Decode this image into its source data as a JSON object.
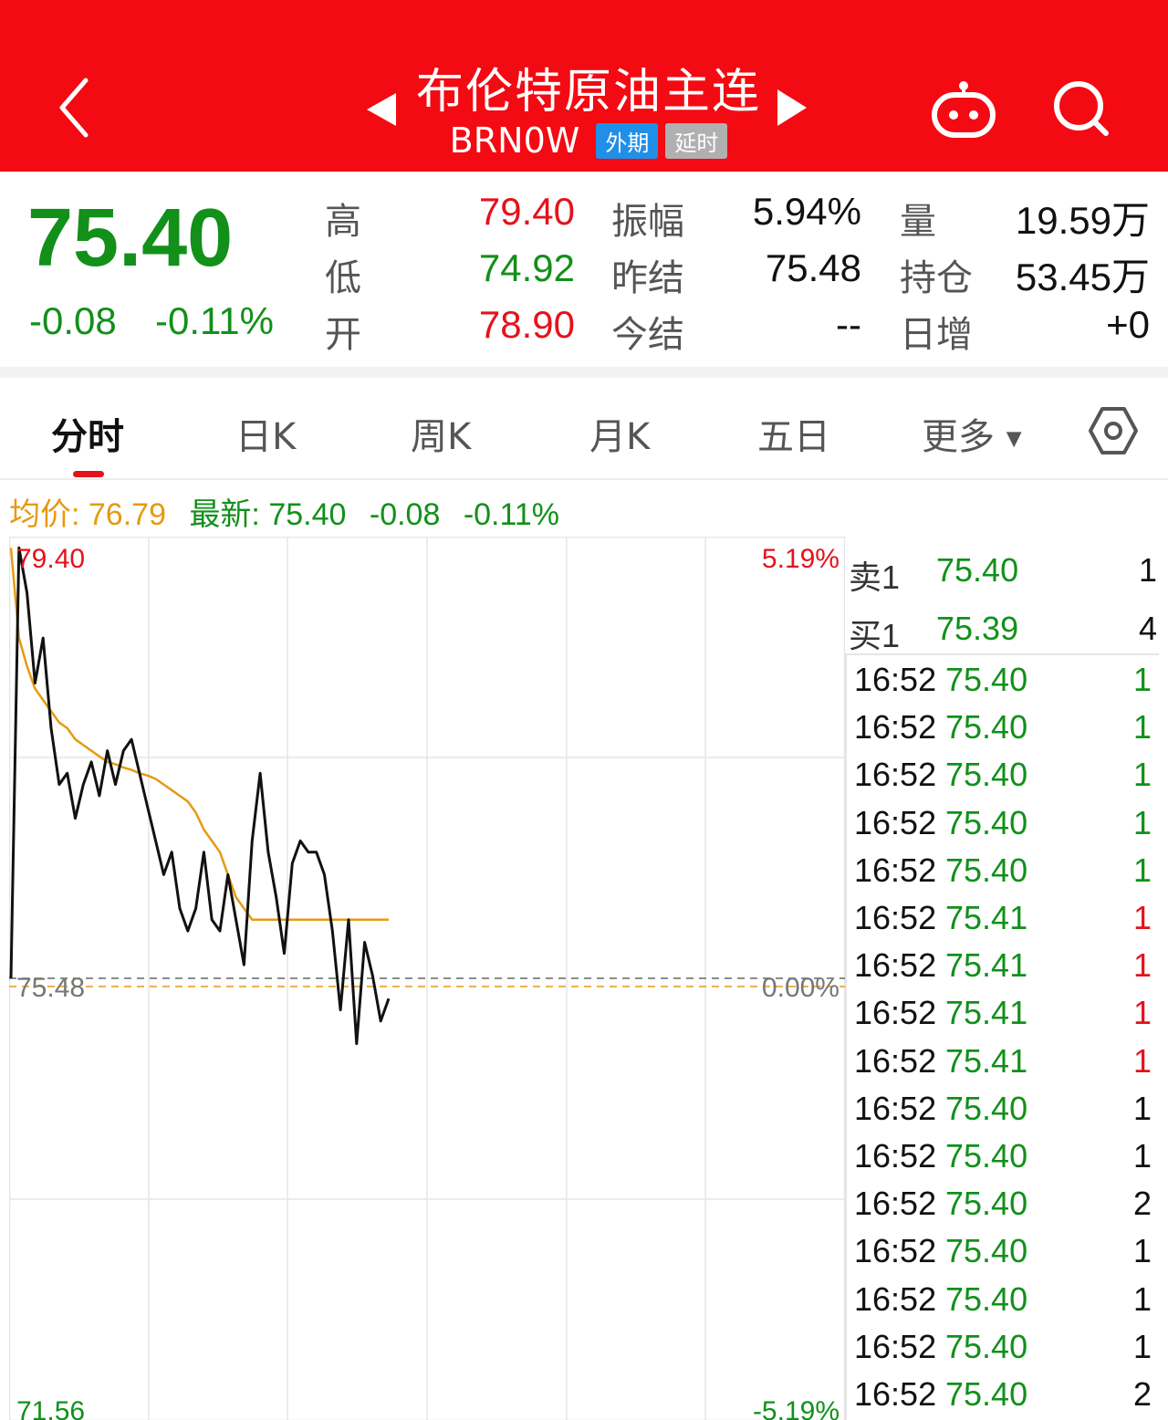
{
  "header": {
    "title": "布伦特原油主连",
    "code": "BRN0W",
    "tag_market": "外期",
    "tag_delay": "延时"
  },
  "quote": {
    "last": "75.40",
    "change": "-0.08",
    "change_pct": "-0.11%",
    "high_label": "高",
    "high": "79.40",
    "low_label": "低",
    "low": "74.92",
    "open_label": "开",
    "open": "78.90",
    "amp_label": "振幅",
    "amp": "5.94%",
    "prev_settle_label": "昨结",
    "prev_settle": "75.48",
    "settle_label": "今结",
    "settle": "--",
    "vol_label": "量",
    "vol": "19.59万",
    "oi_label": "持仓",
    "oi": "53.45万",
    "oi_change_label": "日增",
    "oi_change": "+0"
  },
  "tabs": {
    "t1": "分时",
    "t2": "日K",
    "t3": "周K",
    "t4": "月K",
    "t5": "五日",
    "t6": "更多"
  },
  "info": {
    "avg": "均价: 76.79",
    "latest": "最新: 75.40",
    "change": "-0.08",
    "change_pct": "-0.11%"
  },
  "chart_data": {
    "type": "line",
    "ylim": [
      71.56,
      79.4
    ],
    "ref_price": 75.48,
    "labels": {
      "top_price": "79.40",
      "top_pct": "5.19%",
      "mid_price": "75.48",
      "mid_pct": "0.00%",
      "bot_price": "71.56",
      "bot_pct": "-5.19%"
    },
    "series": [
      {
        "values": [
          75.48,
          79.3,
          78.9,
          78.1,
          78.5,
          77.7,
          77.2,
          77.3,
          76.9,
          77.2,
          77.4,
          77.1,
          77.5,
          77.2,
          77.5,
          77.6,
          77.3,
          77.0,
          76.7,
          76.4,
          76.6,
          76.1,
          75.9,
          76.1,
          76.6,
          76.0,
          75.9,
          76.4,
          76.0,
          75.6,
          76.7,
          77.3,
          76.6,
          76.2,
          75.7,
          76.5,
          76.7,
          76.6,
          76.6,
          76.4,
          75.9,
          75.2,
          76.0,
          74.9,
          75.8,
          75.5,
          75.1,
          75.3
        ]
      },
      {
        "values": [
          79.3,
          78.5,
          78.25,
          78.05,
          77.95,
          77.85,
          77.75,
          77.7,
          77.6,
          77.55,
          77.5,
          77.45,
          77.4,
          77.38,
          77.35,
          77.33,
          77.3,
          77.28,
          77.25,
          77.2,
          77.15,
          77.1,
          77.05,
          76.95,
          76.8,
          76.7,
          76.6,
          76.4,
          76.2,
          76.1,
          76.0,
          76.0,
          76.0,
          76.0,
          76.0,
          76.0,
          76.0,
          76.0,
          76.0,
          76.0,
          76.0,
          76.0,
          76.0,
          76.0,
          76.0,
          76.0,
          76.0,
          76.0
        ]
      }
    ]
  },
  "order_book": [
    {
      "label": "卖1",
      "price": "75.40",
      "vol": "1"
    },
    {
      "label": "买1",
      "price": "75.39",
      "vol": "4"
    }
  ],
  "ticks": [
    {
      "time": "16:52",
      "price": "75.40",
      "vol": "1",
      "dir": "green"
    },
    {
      "time": "16:52",
      "price": "75.40",
      "vol": "1",
      "dir": "green"
    },
    {
      "time": "16:52",
      "price": "75.40",
      "vol": "1",
      "dir": "green"
    },
    {
      "time": "16:52",
      "price": "75.40",
      "vol": "1",
      "dir": "green"
    },
    {
      "time": "16:52",
      "price": "75.40",
      "vol": "1",
      "dir": "green"
    },
    {
      "time": "16:52",
      "price": "75.41",
      "vol": "1",
      "dir": "red"
    },
    {
      "time": "16:52",
      "price": "75.41",
      "vol": "1",
      "dir": "red"
    },
    {
      "time": "16:52",
      "price": "75.41",
      "vol": "1",
      "dir": "red"
    },
    {
      "time": "16:52",
      "price": "75.41",
      "vol": "1",
      "dir": "red"
    },
    {
      "time": "16:52",
      "price": "75.40",
      "vol": "1",
      "dir": "black"
    },
    {
      "time": "16:52",
      "price": "75.40",
      "vol": "1",
      "dir": "black"
    },
    {
      "time": "16:52",
      "price": "75.40",
      "vol": "2",
      "dir": "black"
    },
    {
      "time": "16:52",
      "price": "75.40",
      "vol": "1",
      "dir": "black"
    },
    {
      "time": "16:52",
      "price": "75.40",
      "vol": "1",
      "dir": "black"
    },
    {
      "time": "16:52",
      "price": "75.40",
      "vol": "1",
      "dir": "black"
    },
    {
      "time": "16:52",
      "price": "75.40",
      "vol": "2",
      "dir": "black"
    }
  ],
  "colors": {
    "header_bg": "#f40a12",
    "up": "#e5121b",
    "down": "#12901a",
    "avg_line": "#e69a10",
    "price_line": "#111111"
  }
}
